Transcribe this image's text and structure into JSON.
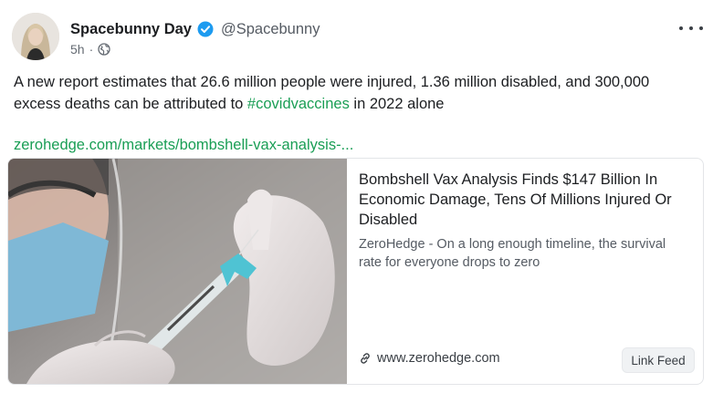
{
  "post": {
    "author": {
      "display_name": "Spacebunny Day",
      "handle": "@Spacebunny",
      "verified": true
    },
    "time": "5h",
    "visibility_icon": "globe-icon",
    "more_icon": "more-horizontal-icon",
    "text_before": "A new report estimates that 26.6 million people were injured, 1.36 million disabled, and 300,000 excess deaths can be attributed to ",
    "hashtag": "#covidvaccines",
    "text_after": " in 2022 alone",
    "link_text": "zerohedge.com/markets/bombshell-vax-analysis-..."
  },
  "card": {
    "title": "Bombshell Vax Analysis Finds $147 Billion In Economic Damage, Tens Of Millions Injured Or Disabled",
    "description": "ZeroHedge - On a long enough timeline, the survival rate for everyone drops to zero",
    "domain": "www.zerohedge.com",
    "link_feed_label": "Link Feed"
  },
  "colors": {
    "accent_green": "#1a9e55",
    "verified_blue": "#1d9bf0",
    "text_primary": "#1c1e21",
    "text_secondary": "#555b63"
  }
}
